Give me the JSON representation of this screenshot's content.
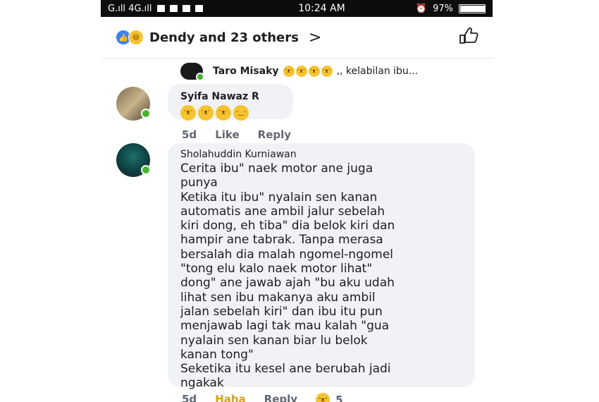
{
  "statusbar": {
    "signal_left": "G.ıll 4G.ıll",
    "time": "10:24 AM",
    "battery_text": "97%",
    "battery_fraction": 0.97
  },
  "reactions_header": {
    "names": "Dendy and 23 others",
    "like_icon": "thumbs-up-icon",
    "haha_icon": "laughing-emoji-icon",
    "chevron": "›"
  },
  "reply_preview": {
    "name": "Taro Misaky",
    "text": ",, kelabilan ibu..."
  },
  "comments": [
    {
      "name": "Syifa Nawaz R",
      "emojis": [
        "laughing",
        "laughing",
        "laughing",
        "smile"
      ],
      "time": "5d",
      "like": "Like",
      "reply": "Reply"
    },
    {
      "name": "Sholahuddin Kurniawan",
      "text": "Cerita ibu\" naek motor ane juga\npunya\nKetika itu ibu\" nyalain sen kanan\nautomatis ane ambil jalur sebelah\nkiri dong, eh tiba\" dia belok kiri dan\nhampir ane tabrak. Tanpa merasa\nbersalah dia malah ngomel-ngomel\n\"tong elu kalo naek motor lihat\"\ndong\" ane jawab ajah \"bu aku udah\nlihat sen ibu makanya aku ambil\njalan sebelah kiri\" dan ibu itu pun\nmenjawab lagi tak mau kalah \"gua\nnyalain sen kanan biar lu belok\nkanan tong\"\nSeketika itu kesel ane berubah jadi\nngakak",
      "time": "5d",
      "haha": "Haha",
      "reply": "Reply",
      "reaction_count": "5"
    }
  ],
  "colors": {
    "accent_blue": "#3b82f6",
    "bubble": "#f0f2f5",
    "online": "#42b72a",
    "haha": "#d4a017"
  }
}
